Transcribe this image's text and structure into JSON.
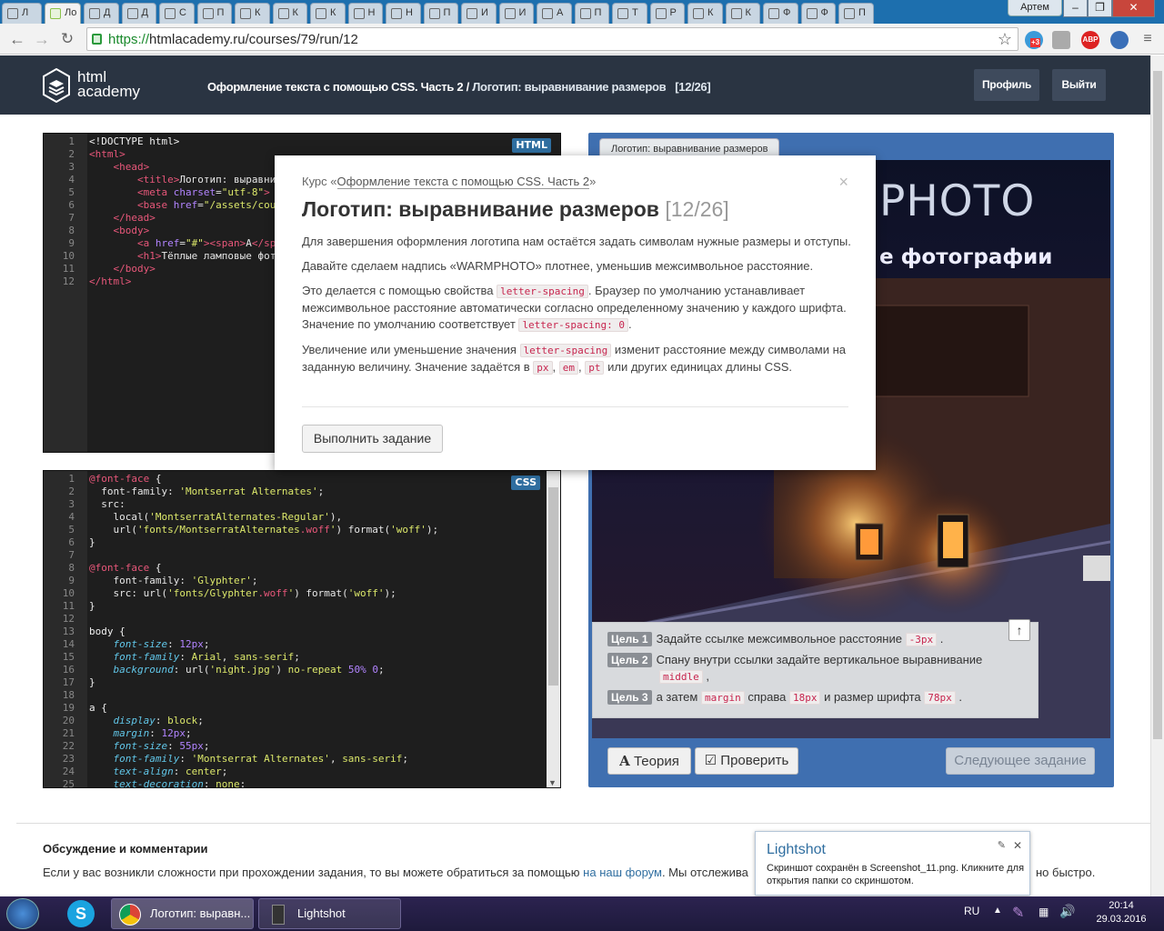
{
  "browser": {
    "tabs": [
      "Л",
      "Ло",
      "Д",
      "Д",
      "С",
      "П",
      "К",
      "К",
      "К",
      "Н",
      "Н",
      "П",
      "И",
      "И",
      "А",
      "П",
      "Т",
      "Р",
      "К",
      "К",
      "Ф",
      "Ф",
      "П"
    ],
    "profile_label": "Артем",
    "url_scheme": "https://",
    "url_rest": "htmlacademy.ru/courses/79/run/12",
    "ext_badge": "+3",
    "abp_label": "ABP"
  },
  "header": {
    "logo_line1": "html",
    "logo_line2": "academy",
    "course": "Оформление текста с помощью CSS. Часть 2 /",
    "lesson": "Логотип: выравнивание размеров",
    "progress": "[12/26]",
    "profile_button": "Профиль",
    "logout_button": "Выйти"
  },
  "html_editor": {
    "lang": "HTML",
    "lines": [
      "1",
      "2",
      "3",
      "4",
      "5",
      "6",
      "7",
      "8",
      "9",
      "10",
      "11",
      "12"
    ]
  },
  "css_editor": {
    "lang": "CSS",
    "lines": [
      "1",
      "2",
      "3",
      "4",
      "5",
      "6",
      "7",
      "8",
      "9",
      "10",
      "11",
      "12",
      "13",
      "14",
      "15",
      "16",
      "17",
      "18",
      "19",
      "20",
      "21",
      "22",
      "23",
      "24",
      "25"
    ]
  },
  "preview": {
    "tab_label": "Логотип: выравнивание размеров",
    "title_visible": "PHOTO",
    "subtitle_visible": "е фотографии",
    "theory_button": "Теория",
    "check_button": "Проверить",
    "next_button": "Следующее задание"
  },
  "goals": {
    "g1_badge": "Цель 1",
    "g1_text": "Задайте ссылке межсимвольное расстояние",
    "g1_val": "-3px",
    "g2_badge": "Цель 2",
    "g2_text": "Спану внутри ссылки задайте вертикальное выравнивание",
    "g2_val": "middle",
    "g3_badge": "Цель 3",
    "g3_text1": "а затем",
    "g3_val1": "margin",
    "g3_text2": "справа",
    "g3_val2": "18px",
    "g3_text3": "и размер шрифта",
    "g3_val3": "78px"
  },
  "modal": {
    "course_prefix": "Курс «",
    "course_link": "Оформление текста с помощью CSS. Часть 2",
    "course_suffix": "»",
    "close": "×",
    "title": "Логотип: выравнивание размеров",
    "counter": "[12/26]",
    "p1": "Для завершения оформления логотипа нам остаётся задать символам нужные размеры и отступы.",
    "p2": "Давайте сделаем надпись «WARMPHOTO» плотнее, уменьшив межсимвольное расстояние.",
    "p3a": "Это делается с помощью свойства",
    "p3_code1": "letter-spacing",
    "p3b": ". Браузер по умолчанию устанавливает межсимвольное расстояние автоматически согласно определенному значению у каждого шрифта. Значение по умолчанию соответствует",
    "p3_code2": "letter-spacing: 0",
    "p3c": ".",
    "p4a": "Увеличение или уменьшение значения",
    "p4_code1": "letter-spacing",
    "p4b": "изменит расстояние между символами на заданную величину. Значение задаётся в",
    "p4_code2": "px",
    "p4_code3": "em",
    "p4_code4": "pt",
    "p4c": "или других единицах длины CSS.",
    "run_button": "Выполнить задание"
  },
  "discussion": {
    "title": "Обсуждение и комментарии",
    "text": "Если у вас возникли сложности при прохождении задания, то вы можете обратиться за помощью",
    "link": "на наш форум",
    "text_after": ". Мы отслежива",
    "text_right": "но быстро."
  },
  "toast": {
    "title": "Lightshot",
    "message": "Скриншот сохранён в Screenshot_11.png. Кликните для открытия папки со скриншотом."
  },
  "taskbar": {
    "chrome_item": "Логотип: выравн...",
    "lightshot_item": "Lightshot",
    "lang": "RU",
    "time": "20:14",
    "date": "29.03.2016"
  }
}
